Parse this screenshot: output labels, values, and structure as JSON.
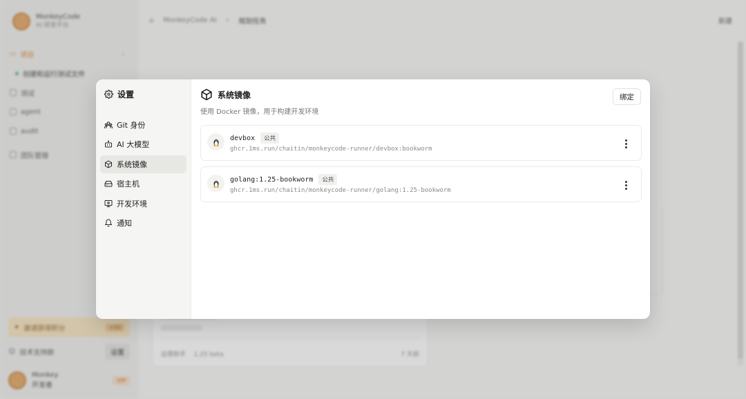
{
  "background": {
    "brand": {
      "name": "MonkeyCode",
      "subtitle": "AI 研发平台"
    },
    "nav": {
      "active_label": "项目",
      "sub_item": "创建和运行测试文件",
      "items": [
        "测试",
        "agent",
        "audit",
        "团队管理"
      ]
    },
    "bottom": {
      "invite_label": "邀请获得积分",
      "invite_badge": "+50",
      "doc_label": "技术支持群",
      "settings_label": "设置",
      "user_name": "Monkey",
      "user_role": "开发者",
      "user_badge": "VIP"
    },
    "topbar": {
      "crumbs": [
        "MonkeyCode AI",
        "›",
        "规划任务"
      ],
      "right_action": "新建"
    },
    "card_footer": {
      "left": "运营助手",
      "mid": "1.25 beta",
      "right": "7 天前"
    }
  },
  "modal": {
    "title": "设置",
    "menu": [
      {
        "id": "git",
        "label": "Git 身份",
        "icon": "users-icon"
      },
      {
        "id": "ai",
        "label": "AI 大模型",
        "icon": "bot-icon"
      },
      {
        "id": "images",
        "label": "系统镜像",
        "icon": "cube-icon",
        "active": true
      },
      {
        "id": "host",
        "label": "宿主机",
        "icon": "hard-drive-icon"
      },
      {
        "id": "devenv",
        "label": "开发环境",
        "icon": "monitor-icon"
      },
      {
        "id": "notify",
        "label": "通知",
        "icon": "bell-icon"
      }
    ],
    "content": {
      "title": "系统镜像",
      "description": "使用 Docker 镜像，用于构建开发环境",
      "bind_button": "绑定",
      "images": [
        {
          "name": "devbox",
          "tag": "公共",
          "url": "ghcr.1ms.run/chaitin/monkeycode-runner/devbox:bookworm"
        },
        {
          "name": "golang:1.25-bookworm",
          "tag": "公共",
          "url": "ghcr.1ms.run/chaitin/monkeycode-runner/golang:1.25-bookworm"
        }
      ]
    }
  },
  "colors": {
    "accent": "#d8822e",
    "modal_bg": "#ffffff",
    "sidebar_bg": "#f5f5f3"
  }
}
